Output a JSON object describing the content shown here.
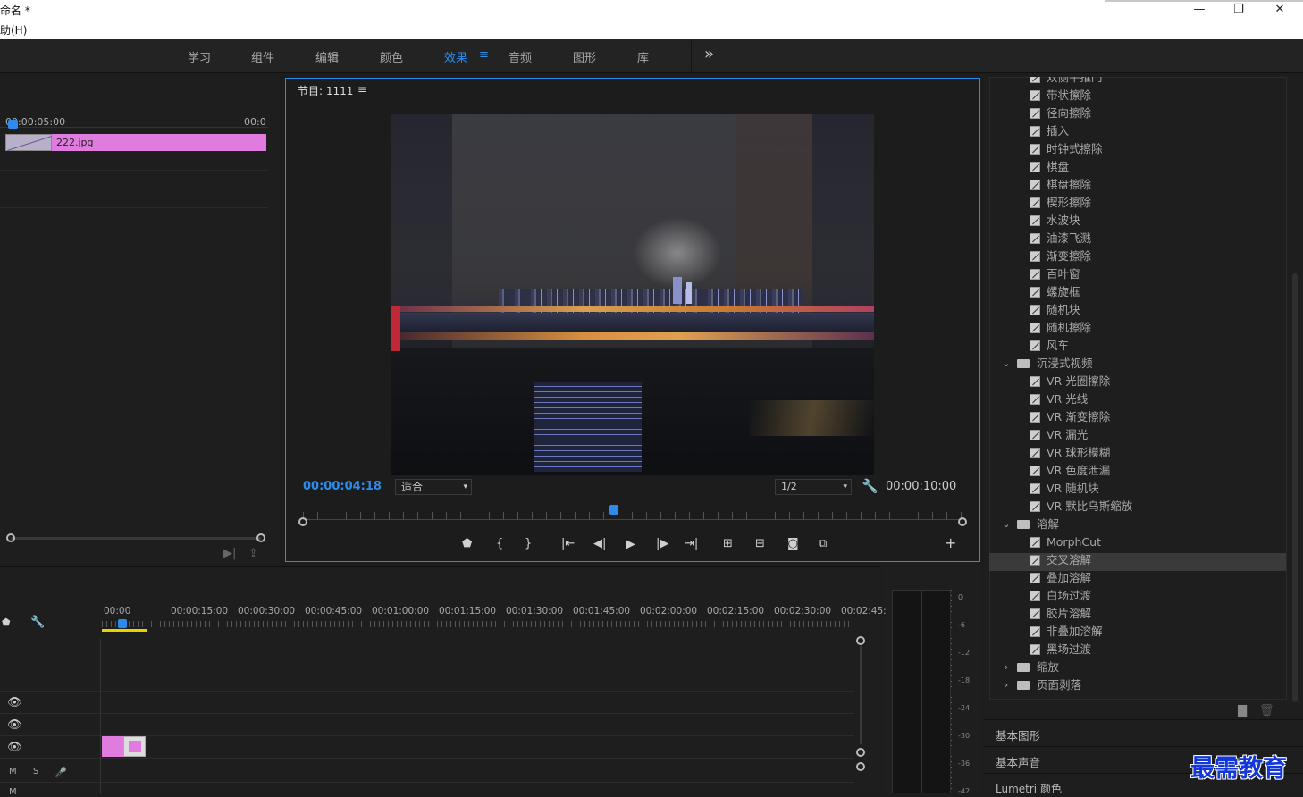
{
  "app": {
    "title_fragment": "命名 *",
    "menu_fragment": "助(H)"
  },
  "window_controls": {
    "minimize": "—",
    "restore": "❐",
    "close": "✕"
  },
  "nav": {
    "tabs": [
      "学习",
      "组件",
      "编辑",
      "颜色",
      "效果",
      "音频",
      "图形",
      "库"
    ],
    "active_tab": "效果",
    "active_menu_icon": "≡",
    "overflow": "»"
  },
  "source_panel": {
    "timecode_left": "00:00:05:00",
    "timecode_right": "00:0",
    "clip_name": "222.jpg",
    "clip_color": "#e07be0"
  },
  "program_monitor": {
    "title": "节目: 1111",
    "menu_icon": "≡",
    "current_time": "00:00:04:18",
    "fit": "适合",
    "resolution": "1/2",
    "duration": "00:00:10:00",
    "playhead_fraction": 0.47
  },
  "effects": {
    "items_top": [
      "双侧平推门",
      "带状擦除",
      "径向擦除",
      "插入",
      "时钟式擦除",
      "棋盘",
      "棋盘擦除",
      "楔形擦除",
      "水波块",
      "油漆飞溅",
      "渐变擦除",
      "百叶窗",
      "螺旋框",
      "随机块",
      "随机擦除",
      "风车"
    ],
    "folder_immersive": "沉浸式视频",
    "items_immersive": [
      "VR 光圈擦除",
      "VR 光线",
      "VR 渐变擦除",
      "VR 漏光",
      "VR 球形模糊",
      "VR 色度泄漏",
      "VR 随机块",
      "VR 默比乌斯缩放"
    ],
    "folder_dissolve": "溶解",
    "items_dissolve": [
      "MorphCut",
      "交叉溶解",
      "叠加溶解",
      "白场过渡",
      "胶片溶解",
      "非叠加溶解",
      "黑场过渡"
    ],
    "selected_item": "交叉溶解",
    "folder_zoom": "缩放",
    "folder_page_peel": "页面剥落"
  },
  "panels_bottom": {
    "essential_graphics": "基本图形",
    "essential_sound": "基本声音",
    "lumetri": "Lumetri 颜色"
  },
  "timeline": {
    "ruler": [
      "00:00",
      "00:00:15:00",
      "00:00:30:00",
      "00:00:45:00",
      "00:01:00:00",
      "00:01:15:00",
      "00:01:30:00",
      "00:01:45:00",
      "00:02:00:00",
      "00:02:15:00",
      "00:02:30:00",
      "00:02:45:"
    ],
    "track_labels": {
      "m": "M",
      "s": "S"
    }
  },
  "audio_meter": {
    "scale": [
      "0",
      "-6",
      "-12",
      "-18",
      "-24",
      "-30",
      "-36",
      "-42"
    ]
  },
  "watermark": "最需教育",
  "colors": {
    "accent": "#2d8ceb",
    "clip": "#e07be0",
    "work_area": "#e5d400"
  }
}
